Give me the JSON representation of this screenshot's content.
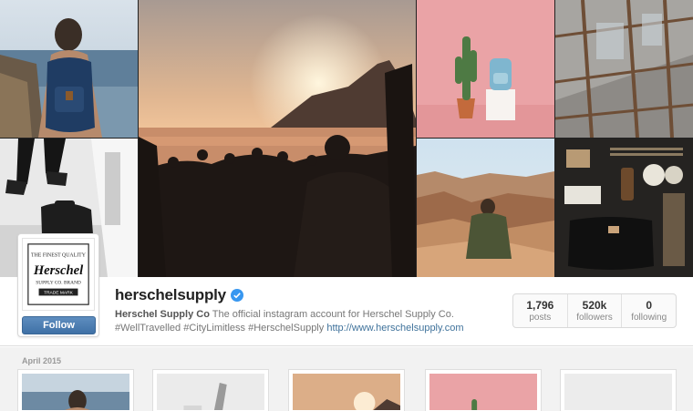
{
  "profile": {
    "username": "herschelsupply",
    "verified": true,
    "full_name": "Herschel Supply Co",
    "bio_text": "The official instagram account for Herschel Supply Co.",
    "hashtags": "#WellTravelled #CityLimitless #HerschelSupply",
    "website": "http://www.herschelsupply.com",
    "follow_label": "Follow"
  },
  "logo": {
    "line1": "THE FINEST QUALITY",
    "brand": "Herschel",
    "line2": "SUPPLY CO. BRAND",
    "line3": "TRADE MARK"
  },
  "stats": [
    {
      "value": "1,796",
      "label": "posts"
    },
    {
      "value": "520k",
      "label": "followers"
    },
    {
      "value": "0",
      "label": "following"
    }
  ],
  "feed": {
    "month": "April 2015"
  },
  "colors": {
    "accent": "#3f729b",
    "follow_button": "#4c7cb0",
    "verified_badge": "#3897f0"
  }
}
